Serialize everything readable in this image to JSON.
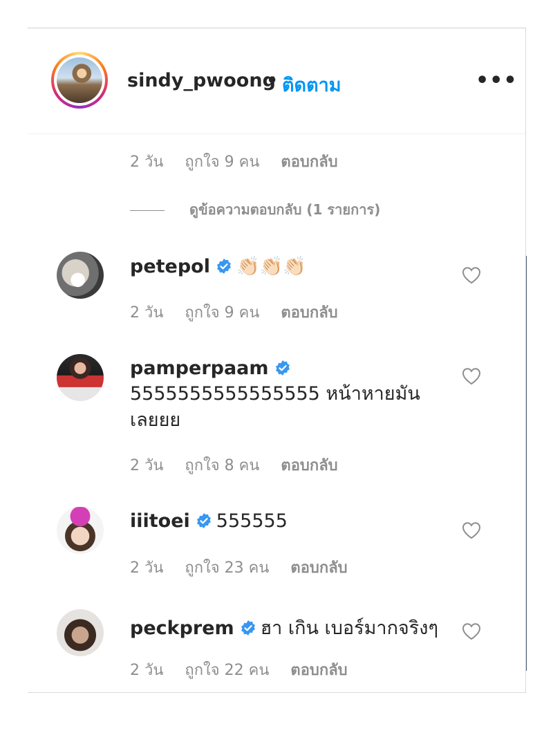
{
  "post_header": {
    "username": "sindy_pwoong",
    "separator": "•",
    "follow_label": "ติดตาม",
    "more_icon": "more-icon",
    "more_glyph": "•••"
  },
  "top_reply_meta": {
    "time": "2 วัน",
    "likes": "ถูกใจ 9 คน",
    "reply": "ตอบกลับ"
  },
  "view_replies": "ดูข้อความตอบกลับ (1 รายการ)",
  "comments": [
    {
      "username": "petepol",
      "text": "👏🏻👏🏻👏🏻",
      "time": "2 วัน",
      "likes": "ถูกใจ 9 คน",
      "reply": "ตอบกลับ",
      "verified": true
    },
    {
      "username": "pamperpaam",
      "text": "5555555555555555 หน้าหายมัน",
      "text2": "เลยยย",
      "time": "2 วัน",
      "likes": "ถูกใจ 8 คน",
      "reply": "ตอบกลับ",
      "verified": true
    },
    {
      "username": "iiitoei",
      "text": "555555",
      "time": "2 วัน",
      "likes": "ถูกใจ 23 คน",
      "reply": "ตอบกลับ",
      "verified": true
    },
    {
      "username": "peckprem",
      "text": "ฮา เกิน เบอร์มากจริงๆ",
      "time": "2 วัน",
      "likes": "ถูกใจ 22 คน",
      "reply": "ตอบกลับ",
      "verified": true
    }
  ],
  "colors": {
    "link_blue": "#0095f6",
    "verified_blue": "#3897f0",
    "meta_gray": "#8e8e8e"
  }
}
